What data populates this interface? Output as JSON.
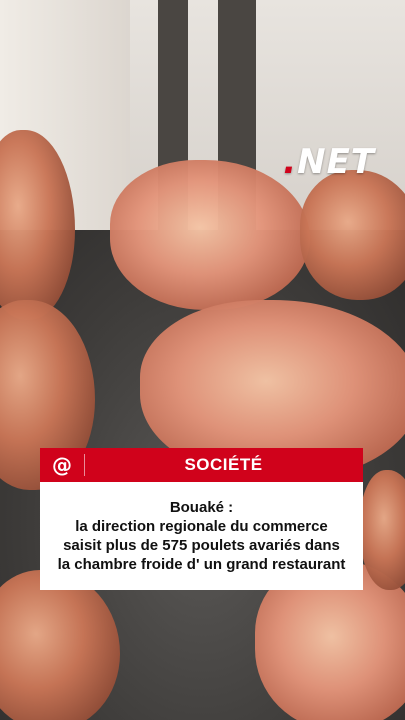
{
  "background": {
    "description_icon": "photo-frozen-chickens"
  },
  "watermark": {
    "dot": ".",
    "text": "NET",
    "dot_color": "#d0021b",
    "text_color": "#ffffff"
  },
  "card": {
    "icon": "at-icon",
    "icon_glyph": "@",
    "category": "SOCIÉTÉ",
    "header_color": "#d0021b",
    "headline_lines": [
      "Bouaké :",
      "la direction regionale du commerce",
      "saisit plus de 575 poulets avariés dans",
      "la chambre froide d' un grand restaurant"
    ]
  }
}
